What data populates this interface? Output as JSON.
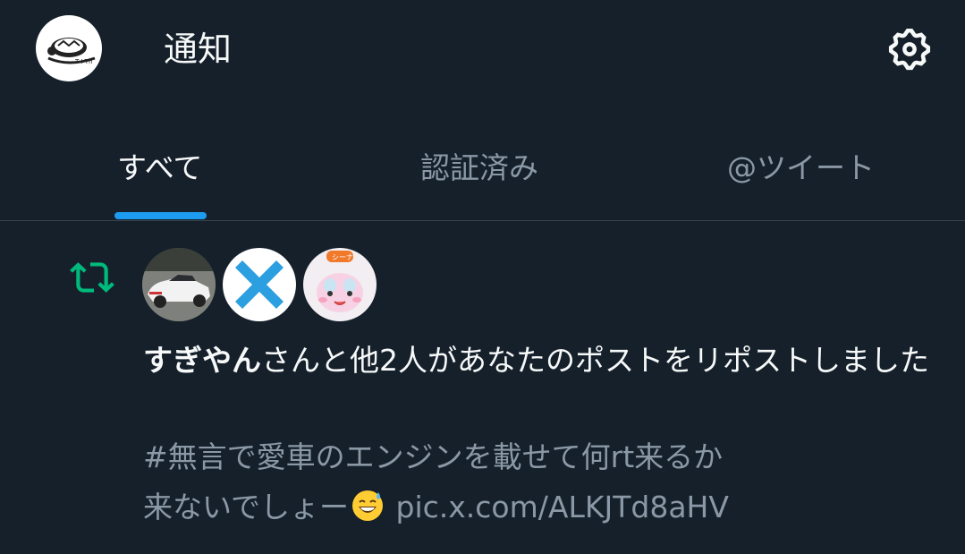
{
  "header": {
    "title": "通知",
    "avatar_icon": "turtle-logo-avatar",
    "settings_icon": "gear-icon"
  },
  "tabs": [
    {
      "label": "すべて",
      "active": true
    },
    {
      "label": "認証済み",
      "active": false
    },
    {
      "label": "@ツイート",
      "active": false
    }
  ],
  "notification": {
    "type_icon": "repost-icon",
    "avatars": [
      "car-photo-avatar",
      "blue-x-avatar",
      "anime-character-avatar"
    ],
    "actor_name": "すぎやん",
    "message_rest": "さんと他2人があなたのポストをリポストしました",
    "tweet_line1": "#無言で愛車のエンジンを載せて何rt来るか",
    "tweet_line2_text": "来ないでしょー",
    "tweet_line2_emoji": "grinning-sweat-emoji",
    "tweet_link": "pic.x.com/ALKJTd8aHV"
  },
  "colors": {
    "background": "#15202b",
    "accent": "#1d9bf0",
    "repost_green": "#00ba7c",
    "secondary_text": "#8b98a5",
    "divider": "#38444d"
  }
}
